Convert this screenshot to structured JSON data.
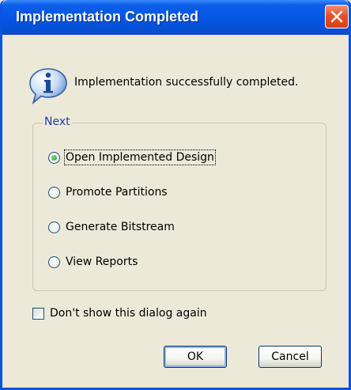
{
  "window": {
    "title": "Implementation Completed",
    "close_icon": "close-x-icon"
  },
  "message": {
    "icon": "info-icon",
    "text": "Implementation successfully completed."
  },
  "next_group": {
    "label": "Next",
    "selected": 0,
    "options": [
      {
        "label": "Open Implemented Design",
        "checked": true
      },
      {
        "label": "Promote Partitions",
        "checked": false
      },
      {
        "label": "Generate Bitstream",
        "checked": false
      },
      {
        "label": "View Reports",
        "checked": false
      }
    ]
  },
  "dont_show": {
    "label": "Don't show this dialog again",
    "checked": false
  },
  "buttons": {
    "ok": "OK",
    "cancel": "Cancel"
  },
  "colors": {
    "titlebar": "#0A5FE8",
    "dialog_bg": "#ECE9D8",
    "close_button": "#E8502A",
    "group_label": "#1F3FA6"
  }
}
